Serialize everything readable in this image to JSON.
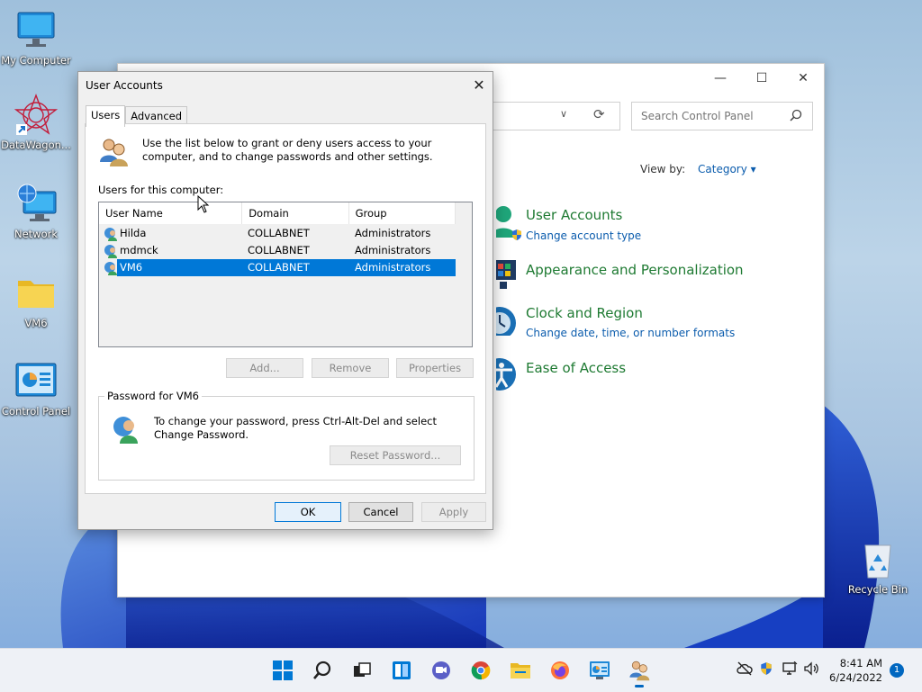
{
  "desktop": {
    "icons": [
      {
        "label": "My Computer"
      },
      {
        "label": "DataWagon..."
      },
      {
        "label": "Network"
      },
      {
        "label": "VM6"
      },
      {
        "label": "Control Panel"
      },
      {
        "label": "Recycle Bin"
      }
    ]
  },
  "control_panel": {
    "search_placeholder": "Search Control Panel",
    "view_by_label": "View by:",
    "view_by_value": "Category",
    "categories": [
      {
        "title": "User Accounts",
        "link": "Change account type"
      },
      {
        "title": "Appearance and Personalization",
        "link": ""
      },
      {
        "title": "Clock and Region",
        "link": "Change date, time, or number formats"
      },
      {
        "title": "Ease of Access",
        "link": ""
      }
    ]
  },
  "dialog": {
    "title": "User Accounts",
    "tabs": [
      {
        "label": "Users"
      },
      {
        "label": "Advanced"
      }
    ],
    "intro": "Use the list below to grant or deny users access to your computer, and to change passwords and other settings.",
    "users_label": "Users for this computer:",
    "columns": [
      "User Name",
      "Domain",
      "Group"
    ],
    "users": [
      {
        "name": "Hilda",
        "domain": "COLLABNET",
        "group": "Administrators"
      },
      {
        "name": "mdmck",
        "domain": "COLLABNET",
        "group": "Administrators"
      },
      {
        "name": "VM6",
        "domain": "COLLABNET",
        "group": "Administrators"
      }
    ],
    "buttons": {
      "add": "Add...",
      "remove": "Remove",
      "properties": "Properties"
    },
    "password_group_label": "Password for VM6",
    "password_text": "To change your password, press Ctrl-Alt-Del and select Change Password.",
    "reset_password": "Reset Password...",
    "ok": "OK",
    "cancel": "Cancel",
    "apply": "Apply"
  },
  "taskbar": {
    "time": "8:41 AM",
    "date": "6/24/2022",
    "notification_count": "1"
  },
  "colors": {
    "accent": "#0078d7",
    "link": "#0b5cad",
    "category_title": "#1e7a32"
  }
}
